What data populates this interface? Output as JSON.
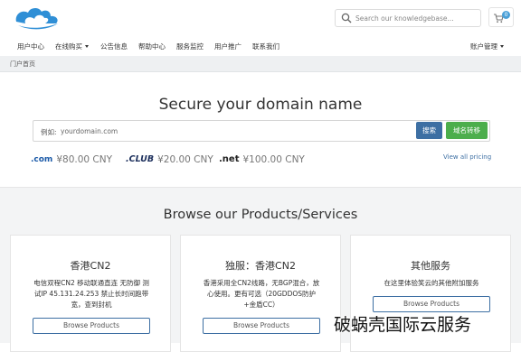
{
  "header": {
    "search_placeholder": "Search our knowledgebase...",
    "cart_count": "0"
  },
  "nav": {
    "items": [
      "用户中心",
      "在线购买",
      "公告信息",
      "帮助中心",
      "服务监控",
      "用户推广",
      "联系我们"
    ],
    "account": "账户管理"
  },
  "breadcrumb": "门户首页",
  "domain": {
    "heading": "Secure your domain name",
    "prefix": "例如:",
    "placeholder": "yourdomain.com",
    "search_btn": "搜索",
    "transfer_btn": "域名转移",
    "tlds": [
      {
        "logo": ".com",
        "price": "¥80.00 CNY"
      },
      {
        "logo": ".CLUB",
        "price": "¥20.00 CNY"
      },
      {
        "logo": ".net",
        "price": "¥100.00 CNY"
      }
    ],
    "view_all": "View all pricing"
  },
  "products": {
    "heading": "Browse our Products/Services",
    "cards": [
      {
        "title": "香港CN2",
        "desc": "电信双程CN2 移动联通直连 无防御 测试IP 45.131.24.253 禁止长时间跑带宽，查到封机",
        "button": "Browse Products"
      },
      {
        "title": "独服：香港CN2",
        "desc": "香港采用全CN2线路，无BGP混合，放心使用。更有可选（20GDDOS防护+金盾CC）",
        "button": "Browse Products"
      },
      {
        "title": "其他服务",
        "desc": "在这里体验笑云的其他附加服务",
        "button": "Browse Products"
      }
    ]
  },
  "watermark": "破蜗壳国际云服务",
  "colors": {
    "primary": "#3d6fa3",
    "success": "#4cae4c",
    "logo": "#2f8fd6"
  }
}
